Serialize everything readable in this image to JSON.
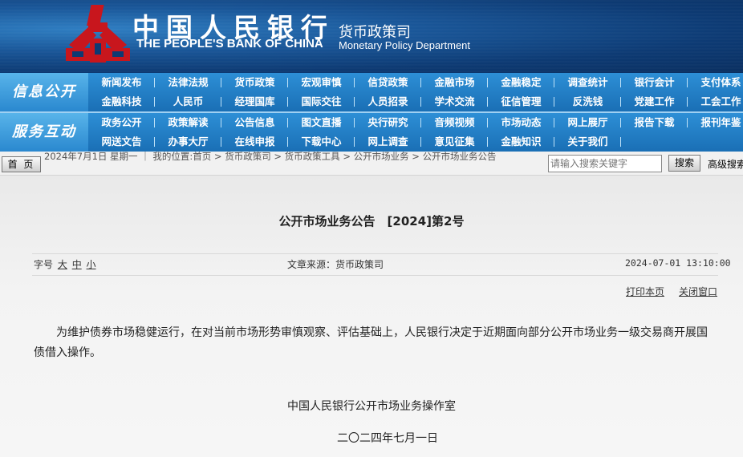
{
  "header": {
    "cn_title": "中国人民银行",
    "en_title": "THE PEOPLE'S BANK OF CHINA",
    "dept_cn": "货币政策司",
    "dept_en": "Monetary Policy Department"
  },
  "nav": {
    "section1_label": "信息公开",
    "section2_label": "服务互动",
    "section1_items": [
      [
        "新闻发布",
        "法律法规",
        "货币政策",
        "宏观审慎",
        "信贷政策",
        "金融市场",
        "金融稳定",
        "调查统计",
        "银行会计",
        "支付体系"
      ],
      [
        "金融科技",
        "人民币",
        "经理国库",
        "国际交往",
        "人员招录",
        "学术交流",
        "征信管理",
        "反洗钱",
        "党建工作",
        "工会工作"
      ]
    ],
    "section2_items": [
      [
        "政务公开",
        "政策解读",
        "公告信息",
        "图文直播",
        "央行研究",
        "音频视频",
        "市场动态",
        "网上展厅",
        "报告下载",
        "报刊年鉴"
      ],
      [
        "网送文告",
        "办事大厅",
        "在线申报",
        "下载中心",
        "网上调查",
        "意见征集",
        "金融知识",
        "关于我们"
      ]
    ]
  },
  "locbar": {
    "home_label": "首 页",
    "date_text": "2024年7月1日 星期一",
    "position_label": "我的位置:",
    "crumbs": [
      "首页",
      "货币政策司",
      "货币政策工具",
      "公开市场业务",
      "公开市场业务公告"
    ],
    "separator": ">",
    "search_placeholder": "请输入搜索关键字",
    "search_button": "搜索",
    "advanced_search": "高级搜索"
  },
  "article": {
    "title": "公开市场业务公告　[2024]第2号",
    "fontsize_label": "字号",
    "fontsize_large": "大",
    "fontsize_medium": "中",
    "fontsize_small": "小",
    "source": "文章来源：货币政策司",
    "date": "2024-07-01  13:10:00",
    "print_label": "打印本页",
    "close_label": "关闭窗口",
    "body": "为维护债券市场稳健运行，在对当前市场形势审慎观察、评估基础上，人民银行决定于近期面向部分公开市场业务一级交易商开展国债借入操作。",
    "signature_org": "中国人民银行公开市场业务操作室",
    "signature_date": "二〇二四年七月一日"
  },
  "colors": {
    "banner_dark": "#0d3a73",
    "nav_blue": "#1a6fb5",
    "nav_label_blue": "#2a88cf",
    "logo_red": "#c8161d"
  }
}
